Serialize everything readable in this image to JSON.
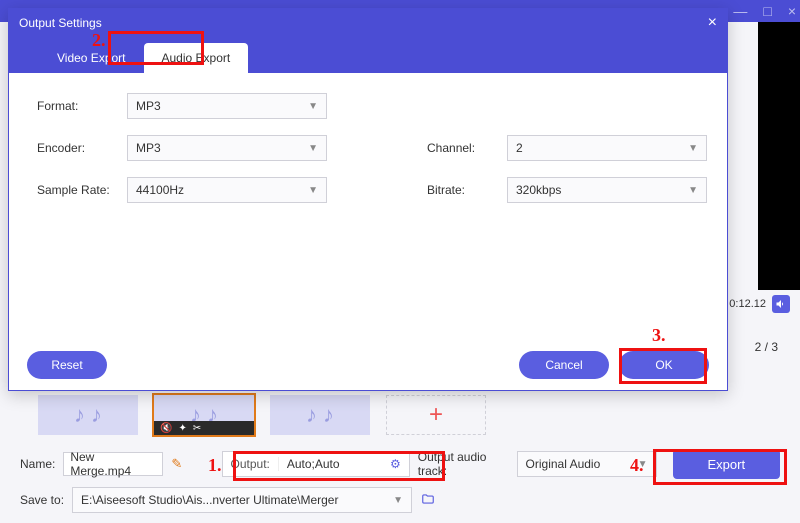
{
  "app": {
    "title": "Output Settings",
    "window_controls": {
      "min": "—",
      "max": "□",
      "close": "×"
    }
  },
  "modal": {
    "title": "Output Settings",
    "tabs": {
      "video": "Video Export",
      "audio": "Audio Export"
    },
    "labels": {
      "format": "Format:",
      "encoder": "Encoder:",
      "sample_rate": "Sample Rate:",
      "channel": "Channel:",
      "bitrate": "Bitrate:"
    },
    "values": {
      "format": "MP3",
      "encoder": "MP3",
      "sample_rate": "44100Hz",
      "channel": "2",
      "bitrate": "320kbps"
    },
    "buttons": {
      "reset": "Reset",
      "cancel": "Cancel",
      "ok": "OK"
    }
  },
  "preview": {
    "time": "0:12.12",
    "page": "2 / 3"
  },
  "bottom": {
    "name_label": "Name:",
    "name_value": "New Merge.mp4",
    "output_label": "Output:",
    "output_value": "Auto;Auto",
    "track_label": "Output audio track:",
    "track_value": "Original Audio",
    "export": "Export",
    "saveto_label": "Save to:",
    "saveto_value": "E:\\Aiseesoft Studio\\Ais...nverter Ultimate\\Merger"
  },
  "annotations": {
    "n1": "1.",
    "n2": "2.",
    "n3": "3.",
    "n4": "4."
  },
  "thumb_add": "+"
}
